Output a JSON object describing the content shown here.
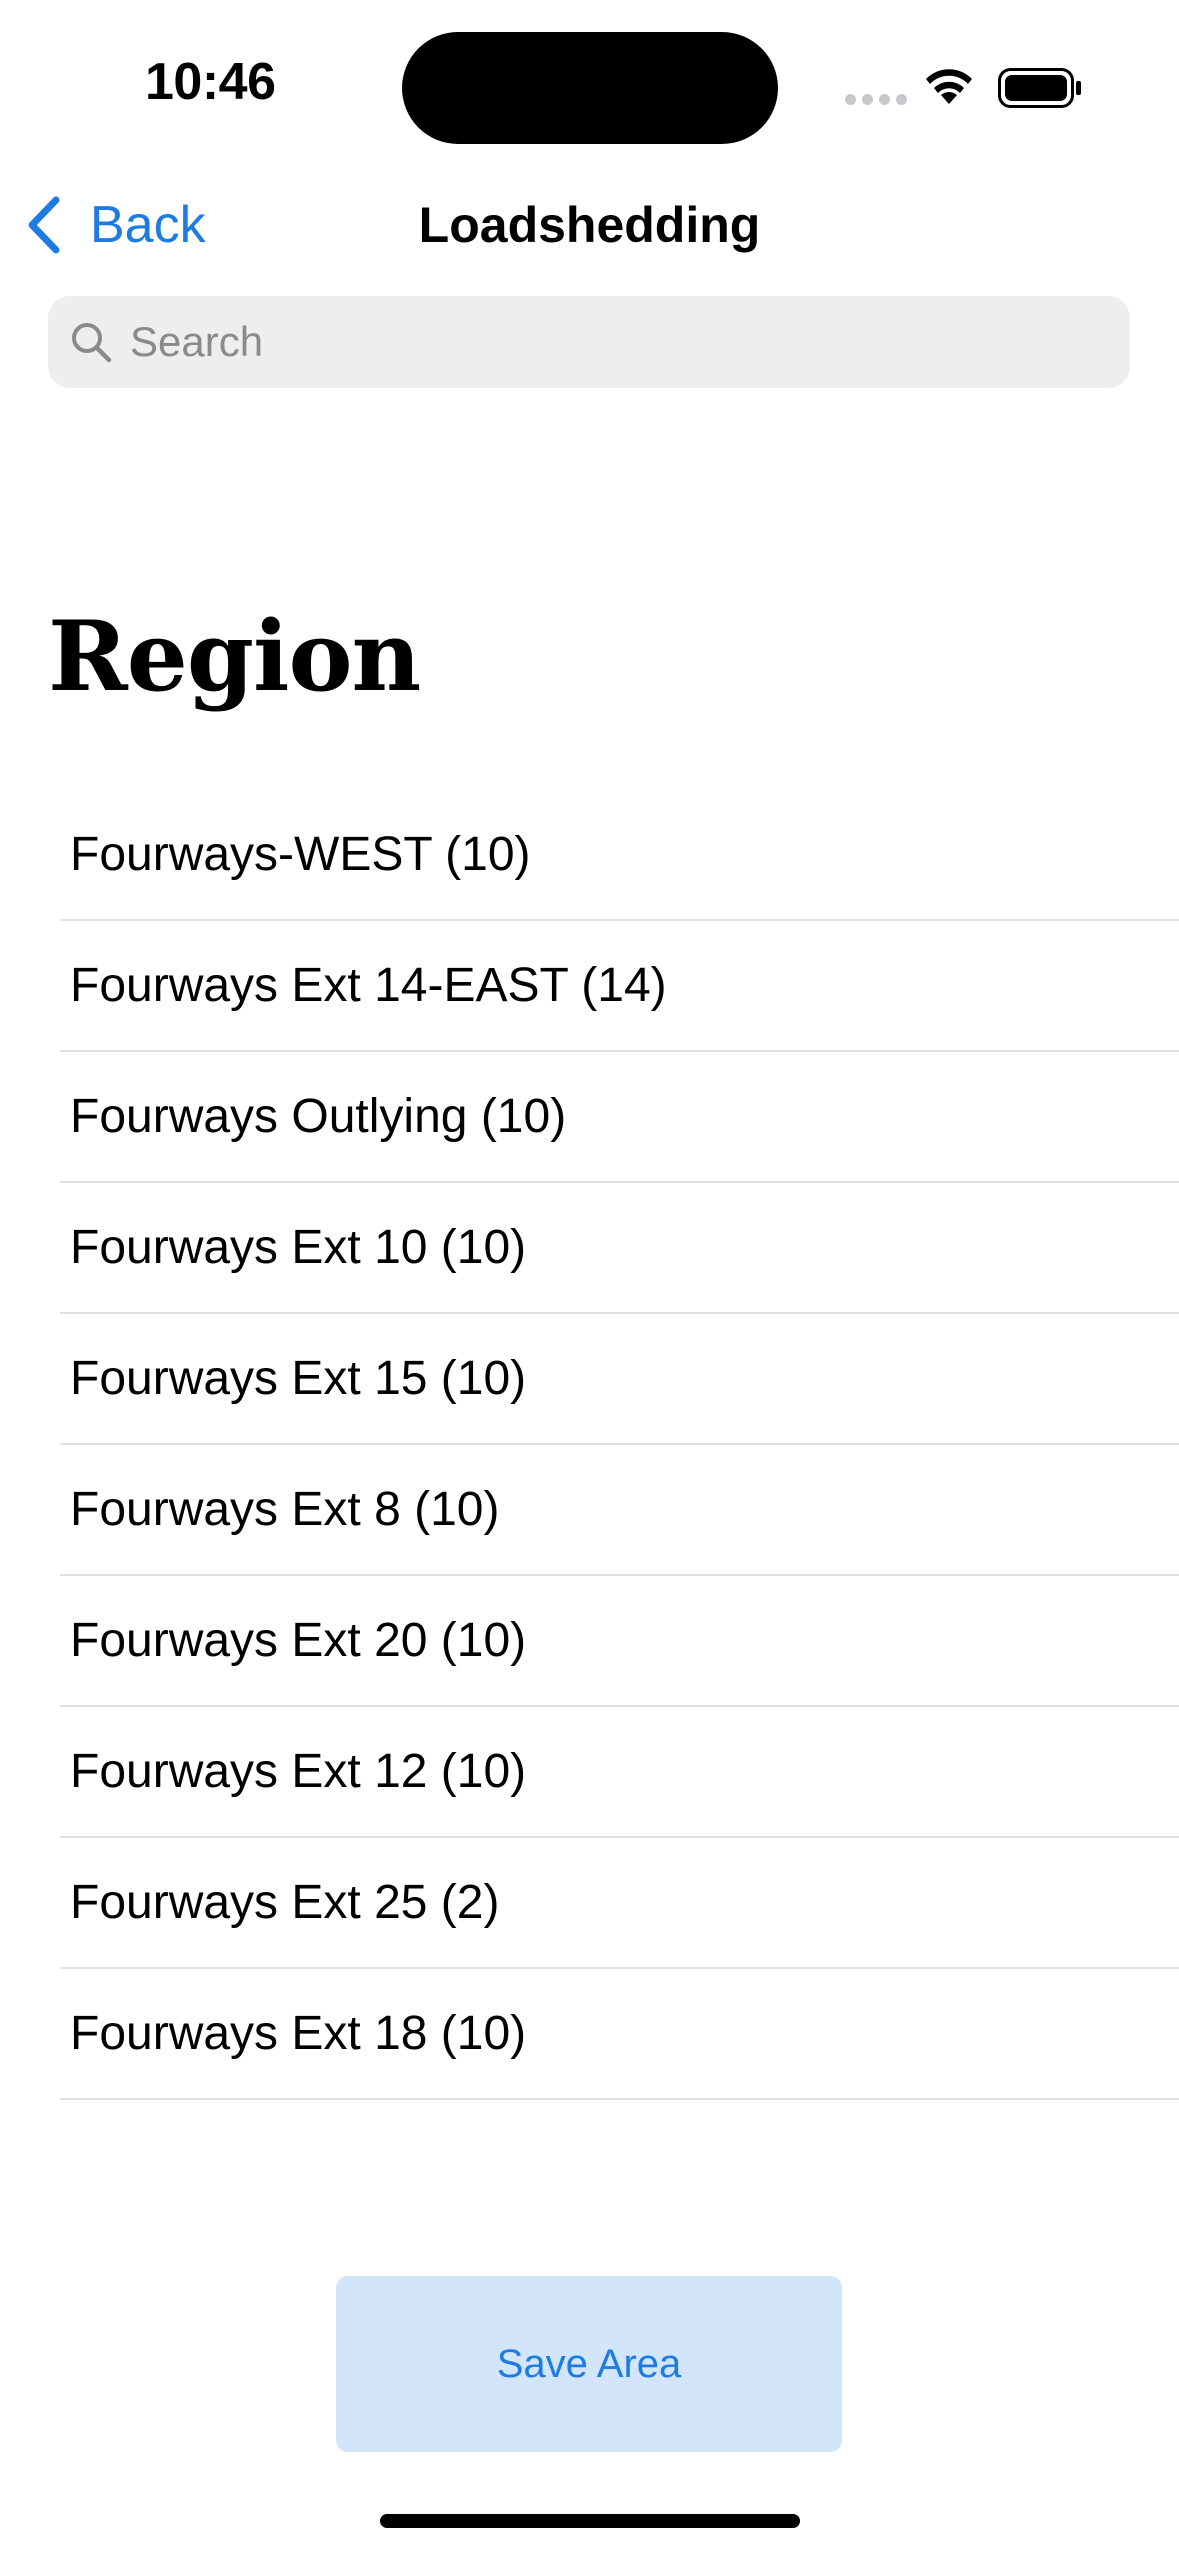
{
  "status_bar": {
    "time": "10:46",
    "icons": [
      "cellular-signal-icon",
      "wifi-icon",
      "battery-icon"
    ]
  },
  "nav": {
    "back_label": "Back",
    "title": "Loadshedding"
  },
  "search": {
    "placeholder": "Search",
    "value": ""
  },
  "section": {
    "title": "Region"
  },
  "regions": [
    "Fourways-WEST (10)",
    "Fourways Ext 14-EAST (14)",
    "Fourways Outlying (10)",
    "Fourways Ext 10 (10)",
    "Fourways Ext 15 (10)",
    "Fourways Ext 8 (10)",
    "Fourways Ext 20 (10)",
    "Fourways Ext 12 (10)",
    "Fourways Ext 25 (2)",
    "Fourways Ext 18 (10)"
  ],
  "actions": {
    "save_label": "Save Area"
  },
  "colors": {
    "accent": "#1c7ce4",
    "button_bg": "#d2e5fb",
    "search_bg": "#eeeeef",
    "divider": "#e1e1e3"
  }
}
